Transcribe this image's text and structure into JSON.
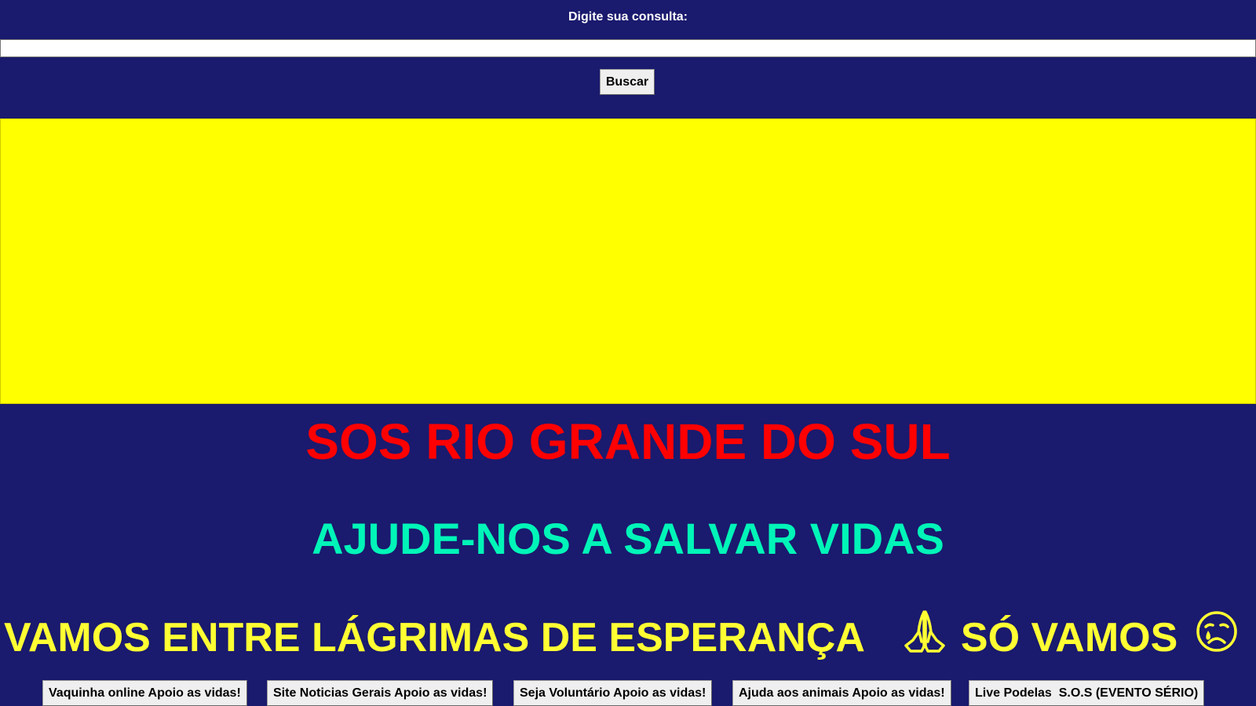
{
  "search": {
    "label": "Digite sua consulta:",
    "value": "",
    "placeholder": "",
    "button_label": "Buscar"
  },
  "banner": {
    "color": "#ffff00"
  },
  "headlines": {
    "title": "SOS RIO GRANDE DO SUL",
    "subtitle": "AJUDE-NOS A SALVAR VIDAS",
    "message_part1": "VAMOS ENTRE LÁGRIMAS DE ESPERANÇA",
    "message_part2": "SÓ VAMOS",
    "icons": [
      "praying-hands-icon",
      "crying-face-icon"
    ]
  },
  "nav_buttons": [
    {
      "label": "Vaquinha online Apoio as vidas!"
    },
    {
      "label": "Site Noticias Gerais Apoio as vidas!"
    },
    {
      "label": "Seja Voluntário Apoio as vidas!"
    },
    {
      "label": "Ajuda aos animais Apoio as vidas!"
    },
    {
      "label": "Live Podelas  S.O.S (EVENTO SÉRIO)"
    }
  ],
  "colors": {
    "background": "#1a1a6e",
    "title": "#ff0000",
    "subtitle": "#00f5b8",
    "message": "#ffff33"
  }
}
